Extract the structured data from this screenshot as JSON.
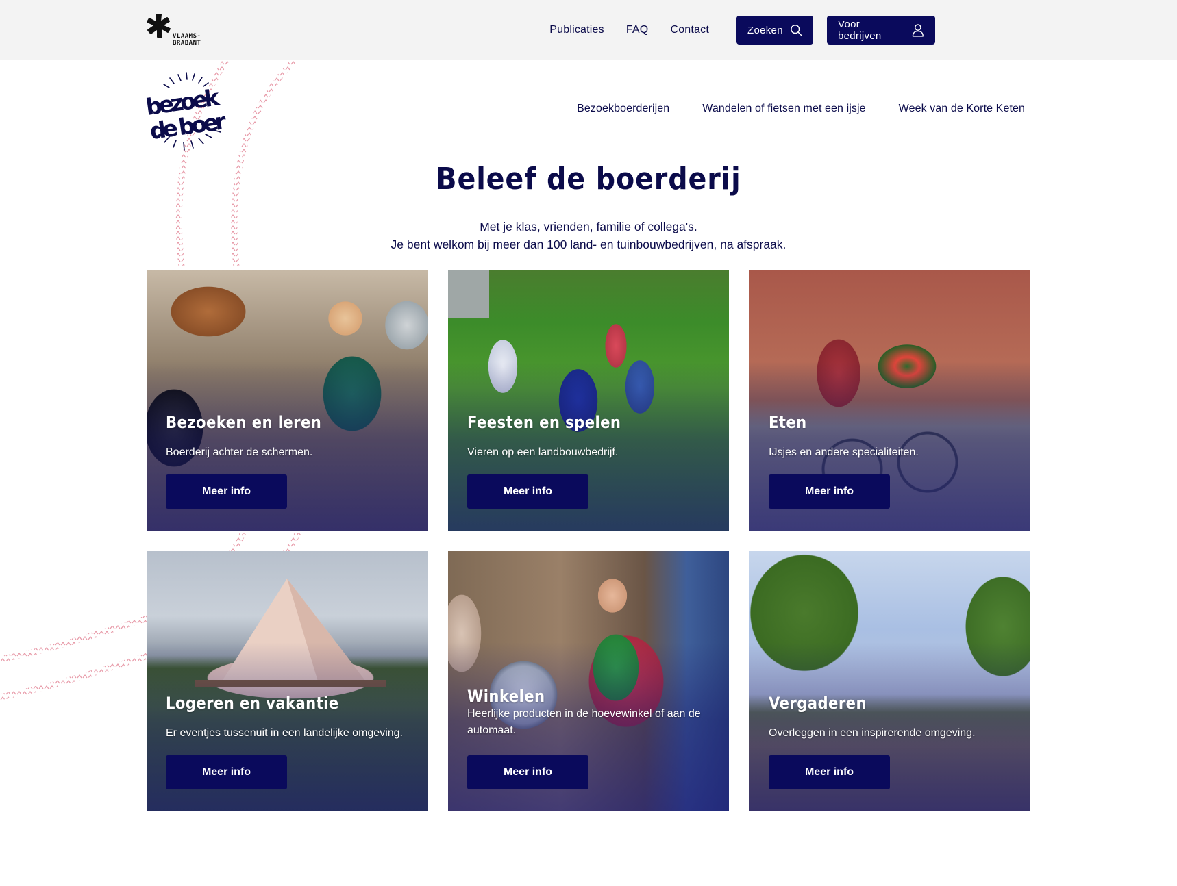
{
  "topbar": {
    "org_logo_text": "VLAAMS-\nBRABANT",
    "links": [
      "Publicaties",
      "FAQ",
      "Contact"
    ],
    "search_label": "Zoeken",
    "company_label": "Voor bedrijven"
  },
  "brand": {
    "logo_text": "bezoek de boer"
  },
  "main_nav": [
    "Bezoekboerderijen",
    "Wandelen of fietsen met een ijsje",
    "Week van de Korte Keten"
  ],
  "hero": {
    "title": "Beleef de boerderij",
    "intro_line1": "Met je klas, vrienden, familie of collega's.",
    "intro_line2": "Je bent welkom bij meer dan 100 land- en tuinbouwbedrijven, na afspraak."
  },
  "cards": [
    {
      "title": "Bezoeken en leren",
      "description": "Boerderij achter de schermen.",
      "button": "Meer info"
    },
    {
      "title": "Feesten en spelen",
      "description": "Vieren op een landbouwbedrijf.",
      "button": "Meer info"
    },
    {
      "title": "Eten",
      "description": "IJsjes en andere specialiteiten.",
      "button": "Meer info"
    },
    {
      "title": "Logeren en vakantie",
      "description": "Er eventjes tussenuit in een landelijke omgeving.",
      "button": "Meer info"
    },
    {
      "title": "Winkelen",
      "description": "Heerlijke producten in de hoevewinkel of aan de automaat.",
      "button": "Meer info"
    },
    {
      "title": "Vergaderen",
      "description": "Overleggen in een inspirerende omgeving.",
      "button": "Meer info"
    }
  ],
  "colors": {
    "navy": "#0a0a5c",
    "topbar_bg": "#f3f3f3",
    "accent_pink": "#e79aa8"
  }
}
